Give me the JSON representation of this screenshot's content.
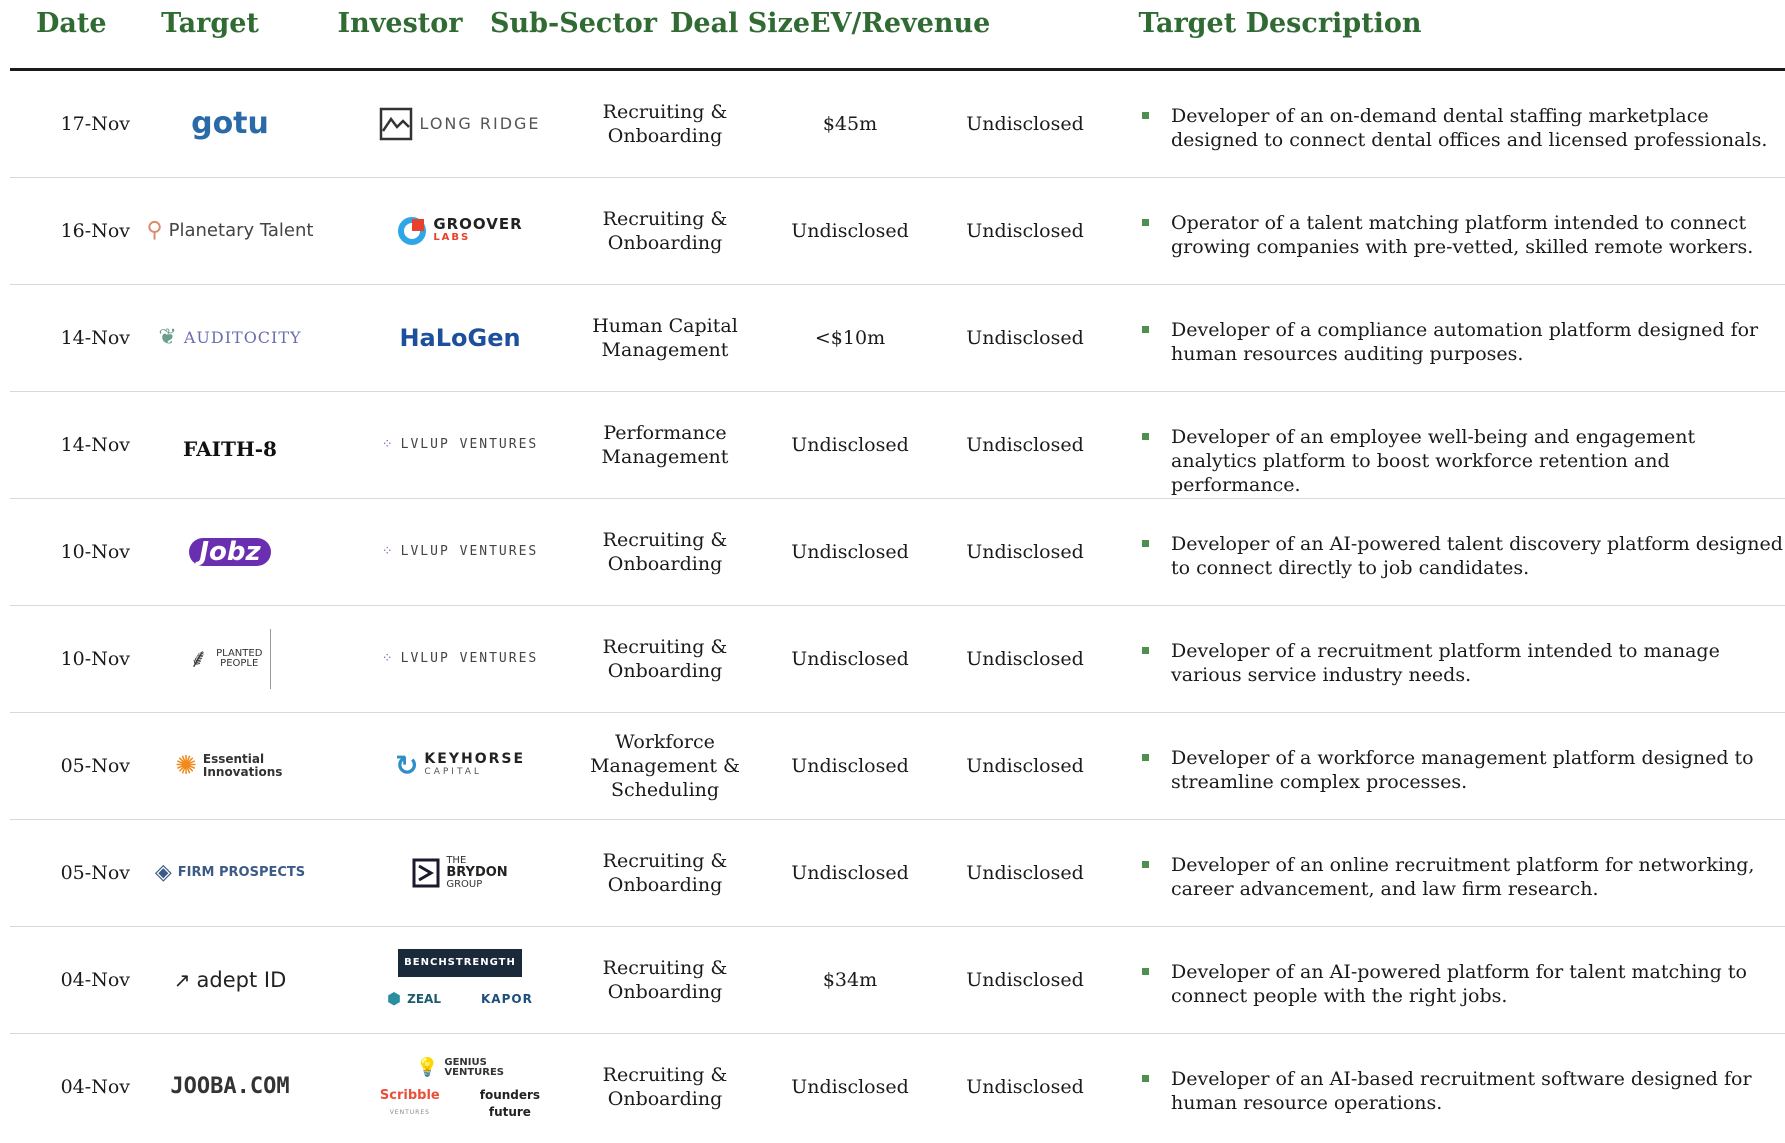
{
  "colors": {
    "header": "#2f6b32",
    "bullet": "#4f8f4f",
    "rule": "#1a1a1a",
    "divider": "#d9d9d9"
  },
  "headers": {
    "date": "Date",
    "target": "Target",
    "investor": "Investor",
    "sub_sector": "Sub-Sector",
    "deal_size": "Deal Size",
    "ev_revenue": "EV/Revenue",
    "description": "Target Description"
  },
  "rows": [
    {
      "date": "17-Nov",
      "target_logo": "gotu",
      "investors": [
        "LONG RIDGE"
      ],
      "sub_sector": "Recruiting &\nOnboarding",
      "deal_size": "$45m",
      "ev_revenue": "Undisclosed",
      "description": "Developer of an on-demand dental staffing marketplace designed to connect dental offices and licensed professionals."
    },
    {
      "date": "16-Nov",
      "target_logo": "Planetary Talent",
      "investors": [
        "GROOVER",
        "LABS"
      ],
      "sub_sector": "Recruiting &\nOnboarding",
      "deal_size": "Undisclosed",
      "ev_revenue": "Undisclosed",
      "description": "Operator of a talent matching platform intended to connect growing companies with pre-vetted, skilled remote workers."
    },
    {
      "date": "14-Nov",
      "target_logo": "AUDITOCITY",
      "investors": [
        "HaLoGen"
      ],
      "sub_sector": "Human Capital\nManagement",
      "deal_size": "<$10m",
      "ev_revenue": "Undisclosed",
      "description": "Developer of a compliance automation platform designed for human resources auditing purposes."
    },
    {
      "date": "14-Nov",
      "target_logo": "FAITH-8",
      "investors": [
        "LVLUP VENTURES"
      ],
      "sub_sector": "Performance\nManagement",
      "deal_size": "Undisclosed",
      "ev_revenue": "Undisclosed",
      "description": "Developer of an employee well-being and engagement analytics platform to boost workforce retention and performance."
    },
    {
      "date": "10-Nov",
      "target_logo": "Jobz",
      "investors": [
        "LVLUP VENTURES"
      ],
      "sub_sector": "Recruiting &\nOnboarding",
      "deal_size": "Undisclosed",
      "ev_revenue": "Undisclosed",
      "description": "Developer of an AI-powered talent discovery platform designed to connect directly to job candidates."
    },
    {
      "date": "10-Nov",
      "target_logo": "PLANTED PEOPLE",
      "investors": [
        "LVLUP VENTURES"
      ],
      "sub_sector": "Recruiting &\nOnboarding",
      "deal_size": "Undisclosed",
      "ev_revenue": "Undisclosed",
      "description": "Developer of a recruitment platform intended to manage various service industry needs."
    },
    {
      "date": "05-Nov",
      "target_logo": "Essential Innovations",
      "investors": [
        "KEYHORSE",
        "CAPITAL"
      ],
      "sub_sector": "Workforce\nManagement &\nScheduling",
      "deal_size": "Undisclosed",
      "ev_revenue": "Undisclosed",
      "description": "Developer of a workforce management platform designed to streamline complex processes."
    },
    {
      "date": "05-Nov",
      "target_logo": "FIRM PROSPECTS",
      "investors": [
        "THE",
        "BRYDON",
        "GROUP"
      ],
      "sub_sector": "Recruiting &\nOnboarding",
      "deal_size": "Undisclosed",
      "ev_revenue": "Undisclosed",
      "description": "Developer of an online recruitment platform for networking, career advancement, and law firm research."
    },
    {
      "date": "04-Nov",
      "target_logo": "adept ID",
      "investors": [
        "BENCHSTRENGTH",
        "ZEAL",
        "KAPOR"
      ],
      "sub_sector": "Recruiting &\nOnboarding",
      "deal_size": "$34m",
      "ev_revenue": "Undisclosed",
      "description": "Developer of an AI-powered platform for talent matching to connect people with the right jobs."
    },
    {
      "date": "04-Nov",
      "target_logo": "JOOBA.COM",
      "investors": [
        "GENIUS",
        "VENTURES",
        "Scribble",
        "VENTURES",
        "founders",
        "future"
      ],
      "sub_sector": "Recruiting &\nOnboarding",
      "deal_size": "Undisclosed",
      "ev_revenue": "Undisclosed",
      "description": "Developer of an AI-based recruitment software designed for human resource operations."
    }
  ]
}
